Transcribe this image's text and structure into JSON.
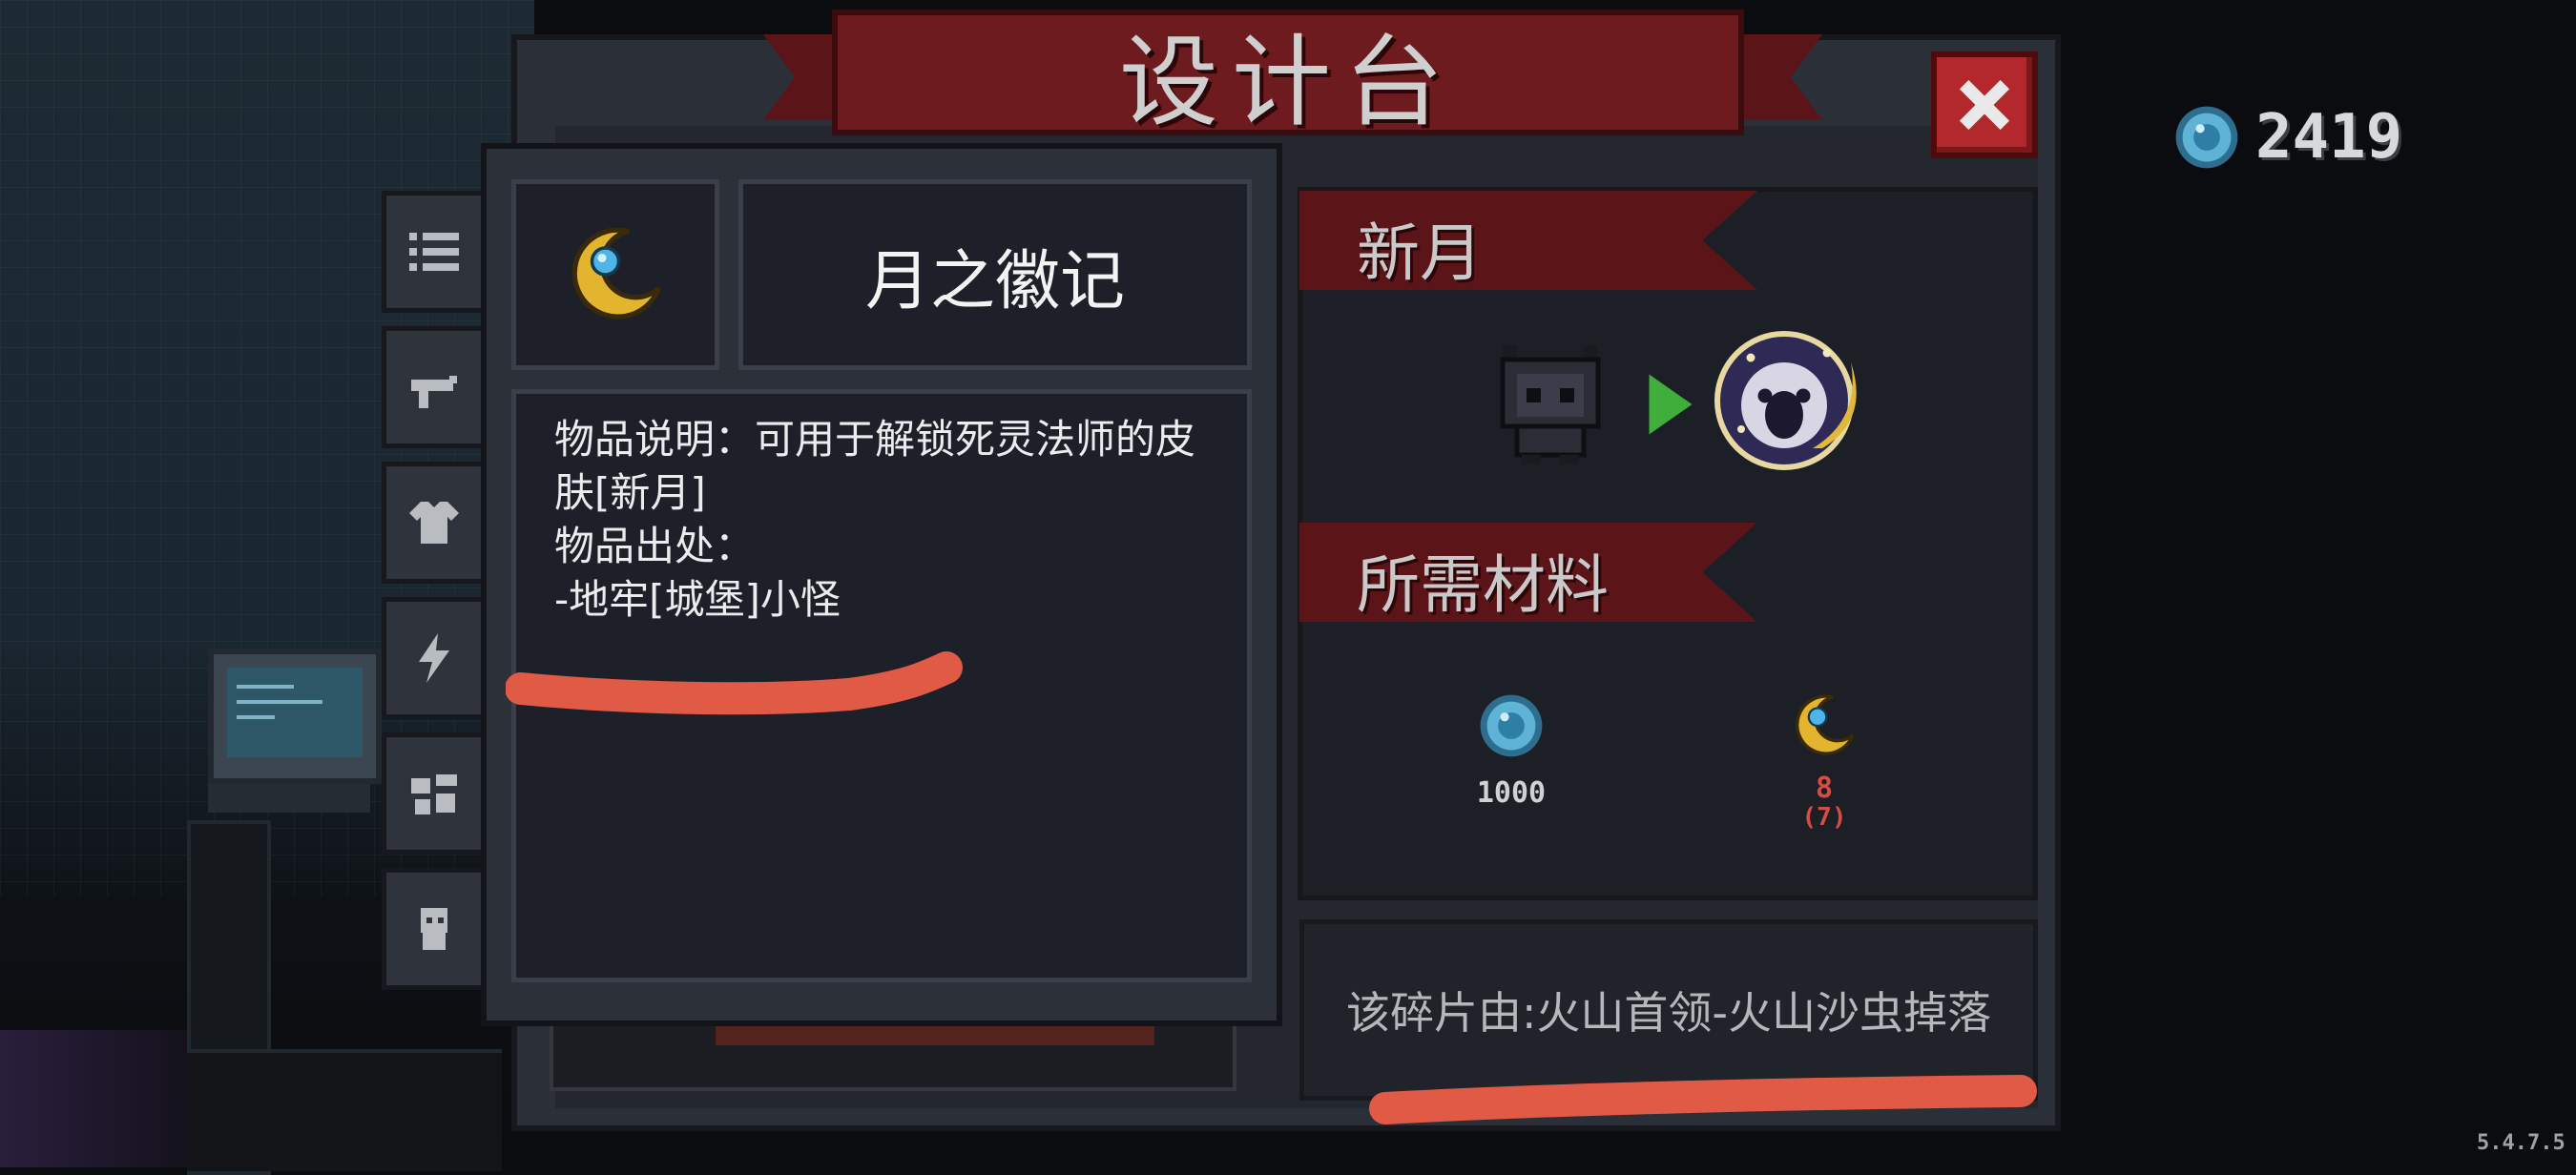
{
  "workbench": {
    "title": "设计台",
    "close_icon": "close-x-icon"
  },
  "currency": {
    "icon": "blue-gem-coin-icon",
    "count": "2419"
  },
  "side_tabs": [
    {
      "name": "list-icon"
    },
    {
      "name": "gun-icon"
    },
    {
      "name": "shirt-icon"
    },
    {
      "name": "lightning-icon"
    },
    {
      "name": "parts-icon"
    },
    {
      "name": "character-icon"
    }
  ],
  "item_popup": {
    "icon": "crescent-moon-icon",
    "name": "月之徽记",
    "description_lines": [
      "物品说明：可用于解锁死灵法师的皮",
      "肤[新月]",
      "物品出处：",
      "-地牢[城堡]小怪"
    ]
  },
  "recipe": {
    "skin_section_title": "新月",
    "materials_section_title": "所需材料",
    "materials": [
      {
        "name": "blue-gem-coin-icon",
        "amount": "1000"
      },
      {
        "name": "crescent-moon-icon",
        "amount": "8",
        "owned": "(7)"
      }
    ],
    "source_note": "该碎片由:火山首领-火山沙虫掉落"
  },
  "colors": {
    "ribbon": "#6e1b1f",
    "close_button": "#b2282c",
    "scribble": "#e05a45",
    "insufficient": "#d94b45"
  },
  "version": "5.4.7.5"
}
